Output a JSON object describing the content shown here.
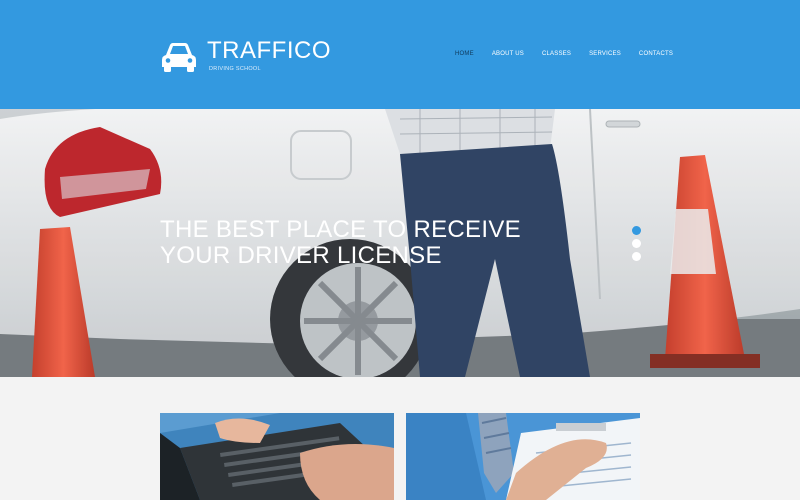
{
  "brand": {
    "name": "TRAFFICO",
    "tagline": "DRIVING SCHOOL",
    "icon": "car-icon"
  },
  "nav": {
    "items": [
      {
        "label": "HOME",
        "active": true
      },
      {
        "label": "ABOUT US",
        "active": false
      },
      {
        "label": "CLASSES",
        "active": false
      },
      {
        "label": "SERVICES",
        "active": false
      },
      {
        "label": "CONTACTS",
        "active": false
      }
    ]
  },
  "hero": {
    "line1": "THE BEST PLACE TO RECEIVE",
    "line2": "YOUR DRIVER LICENSE",
    "slides": 3,
    "active_slide": 1
  },
  "colors": {
    "header_bg": "#3399e0",
    "nav_active": "#0f3a5c",
    "page_bg": "#f3f3f3"
  }
}
